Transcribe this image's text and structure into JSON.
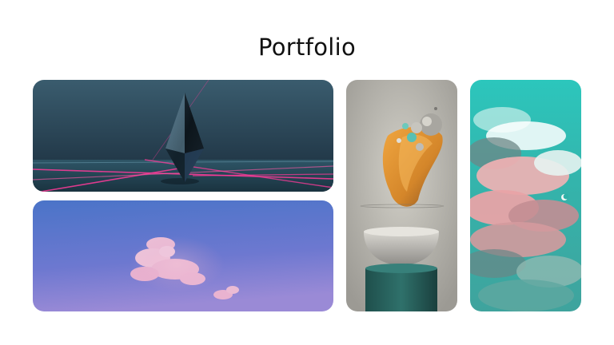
{
  "page": {
    "title": "Portfolio"
  },
  "gallery": {
    "items": [
      {
        "icon": "abstract-crystal-neon-image"
      },
      {
        "icon": "pink-cloud-blue-sky-image"
      },
      {
        "icon": "3d-sculpture-pedestal-image"
      },
      {
        "icon": "pink-clouds-teal-sky-image"
      }
    ]
  },
  "colors": {
    "title": "#111111",
    "background": "#ffffff",
    "neon": "#ff3b9a",
    "teal": "#2bbfb3"
  }
}
